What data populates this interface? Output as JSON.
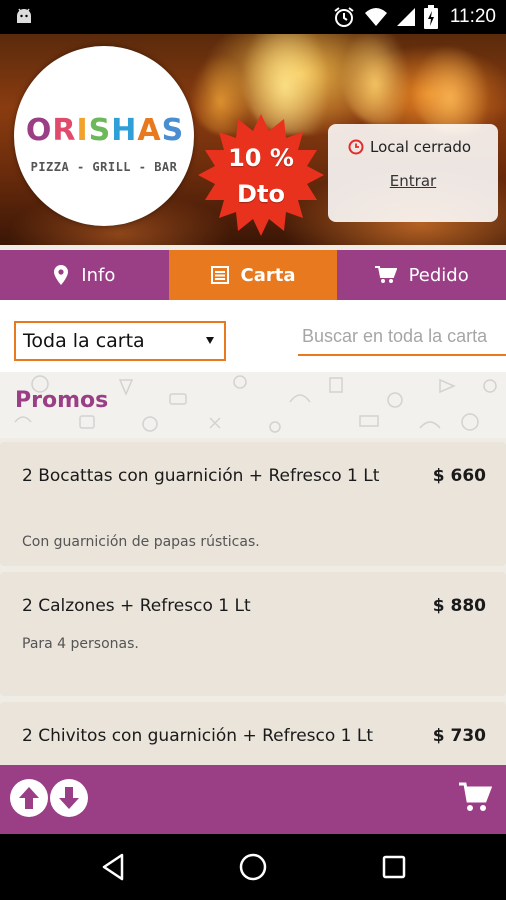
{
  "status_bar": {
    "time": "11:20",
    "icons": [
      "android-icon",
      "alarm-icon",
      "wifi-icon",
      "signal-icon",
      "battery-charging-icon"
    ]
  },
  "header": {
    "logo": {
      "letters": [
        "O",
        "R",
        "I",
        "S",
        "H",
        "A",
        "S"
      ],
      "letter_colors": [
        "#9a3e86",
        "#e14a6a",
        "#f2a22a",
        "#6db85a",
        "#2e9fd7",
        "#e8791e",
        "#4a8ed1"
      ],
      "tagline": "PIZZA - GRILL - BAR"
    },
    "discount_badge": {
      "line1": "10 %",
      "line2": "Dto",
      "color": "#e8321e"
    },
    "store_status": {
      "label": "Local cerrado",
      "link": "Entrar",
      "icon": "clock-icon"
    }
  },
  "tabs": [
    {
      "label": "Info",
      "icon": "location-pin-icon",
      "active": false
    },
    {
      "label": "Carta",
      "icon": "menu-list-icon",
      "active": true
    },
    {
      "label": "Pedido",
      "icon": "cart-icon",
      "active": false
    }
  ],
  "filter": {
    "selected": "Toda la carta",
    "search_placeholder": "Buscar en toda la carta"
  },
  "section": {
    "title": "Promos"
  },
  "items": [
    {
      "name": "2 Bocattas con guarnición + Refresco 1 Lt",
      "price": "$ 660",
      "description": "Con guarnición de papas rústicas."
    },
    {
      "name": "2 Calzones + Refresco 1 Lt",
      "price": "$ 880",
      "description": "Para 4 personas."
    },
    {
      "name": "2 Chivitos con guarnición + Refresco 1 Lt",
      "price": "$ 730",
      "description": ""
    }
  ],
  "bottom_bar": {
    "icons": [
      "arrow-up-icon",
      "arrow-down-icon",
      "cart-icon"
    ]
  },
  "nav_bar": {
    "icons": [
      "back-icon",
      "home-icon",
      "recents-icon"
    ]
  },
  "colors": {
    "primary": "#9a3e86",
    "accent": "#e8791e",
    "card": "#eae4db"
  }
}
